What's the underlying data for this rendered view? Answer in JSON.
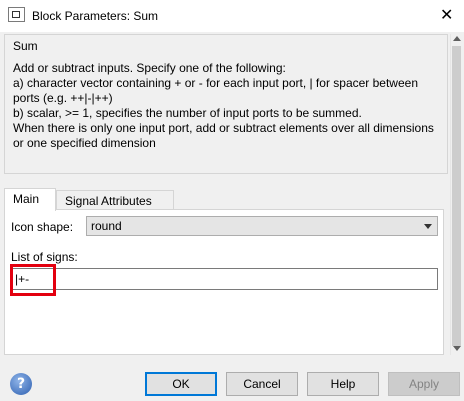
{
  "window": {
    "title": "Block Parameters: Sum",
    "close_glyph": "✕"
  },
  "description": {
    "legend": "Sum",
    "text": "Add or subtract inputs.  Specify one of the following:\na) character vector containing + or - for each input port, | for spacer between ports (e.g. ++|-|++)\nb) scalar, >= 1, specifies the number of input ports to be summed.\nWhen there is only one input port, add or subtract elements over all dimensions or one specified dimension"
  },
  "tabs": [
    {
      "label": "Main",
      "active": true
    },
    {
      "label": "Signal Attributes",
      "active": false
    }
  ],
  "main": {
    "icon_shape_label": "Icon shape:",
    "icon_shape_value": "round",
    "signs_label": "List of signs:",
    "signs_value": "|+-"
  },
  "buttons": {
    "help_icon": "?",
    "ok": "OK",
    "cancel": "Cancel",
    "help": "Help",
    "apply": "Apply"
  },
  "colors": {
    "highlight": "#e3000f",
    "dialog_bg": "#f0f0f0",
    "ok_border": "#0078d7"
  },
  "icons": [
    "simulink-block-icon",
    "close-icon",
    "dropdown-arrow-icon",
    "help-icon",
    "scroll-up-icon",
    "scroll-down-icon"
  ]
}
